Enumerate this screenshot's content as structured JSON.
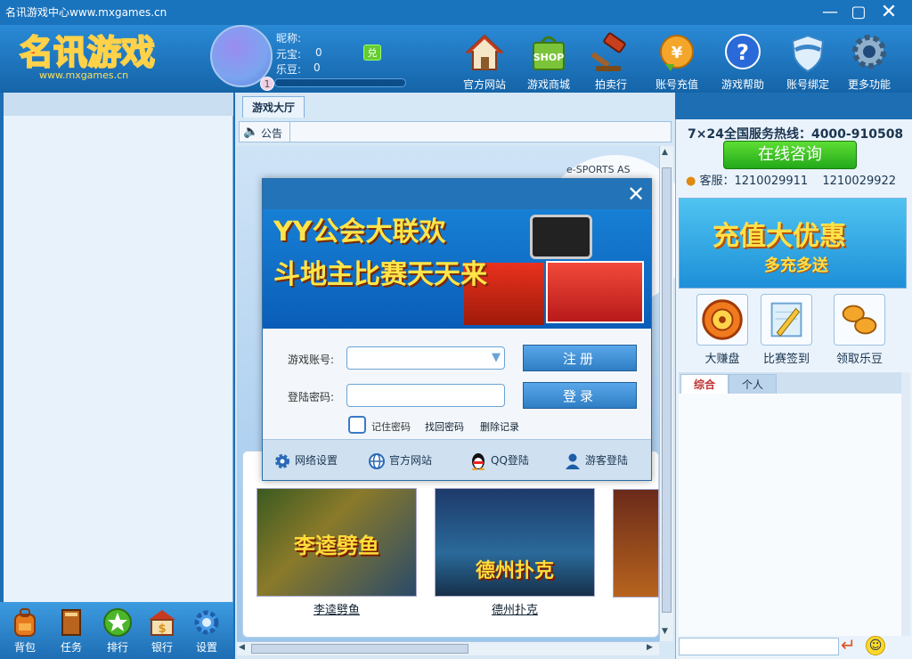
{
  "window": {
    "title": "名讯游戏中心www.mxgames.cn"
  },
  "logo": {
    "text": "名讯游戏",
    "sub": "www.mxgames.cn"
  },
  "user": {
    "nickname_label": "昵称:",
    "yuanbao_label": "元宝:",
    "yuanbao_value": "0",
    "ledou_label": "乐豆:",
    "ledou_value": "0",
    "level": "1",
    "exchange_label": "兑"
  },
  "nav": [
    {
      "label": "官方网站",
      "icon": "house-icon"
    },
    {
      "label": "游戏商城",
      "icon": "shop-bag-icon",
      "badge": "SHOP"
    },
    {
      "label": "拍卖行",
      "icon": "gavel-icon"
    },
    {
      "label": "账号充值",
      "icon": "coin-yuan-icon"
    },
    {
      "label": "游戏帮助",
      "icon": "help-icon"
    },
    {
      "label": "账号绑定",
      "icon": "shield-icon"
    },
    {
      "label": "更多功能",
      "icon": "gear-icon"
    }
  ],
  "left_bottom": [
    {
      "label": "背包",
      "icon": "backpack-icon"
    },
    {
      "label": "任务",
      "icon": "book-icon"
    },
    {
      "label": "排行",
      "icon": "star-icon"
    },
    {
      "label": "银行",
      "icon": "bank-icon"
    },
    {
      "label": "设置",
      "icon": "gear-icon"
    }
  ],
  "center": {
    "tab": "游戏大厅",
    "notice_label": "公告",
    "bg_badge": "e-SPORTS AS"
  },
  "games": [
    {
      "title": "李逵劈鱼",
      "thumb_text": "李逵劈鱼"
    },
    {
      "title": "德州扑克",
      "thumb_text": "德州扑克"
    }
  ],
  "dialog": {
    "close": "✕",
    "banner_line1": "YY公会大联欢",
    "banner_line2": "斗地主比赛天天来",
    "account_label": "游戏账号:",
    "password_label": "登陆密码:",
    "register_btn": "注册",
    "login_btn": "登录",
    "remember": "记住密码",
    "recover": "找回密码",
    "delete": "删除记录",
    "footer": [
      {
        "label": "网络设置",
        "icon": "gear-icon"
      },
      {
        "label": "官方网站",
        "icon": "globe-icon"
      },
      {
        "label": "QQ登陆",
        "icon": "qq-penguin-icon"
      },
      {
        "label": "游客登陆",
        "icon": "person-icon"
      }
    ]
  },
  "right": {
    "hotline": "7×24全国服务热线：4000-910508",
    "consult_btn": "在线咨询",
    "cs_label": "客服：1210029911",
    "cs_second": "1210029922",
    "promo_line1": "充值大优惠",
    "promo_line2": "多充多送",
    "features": [
      {
        "label": "大赚盘",
        "icon": "wheel-icon"
      },
      {
        "label": "比赛签到",
        "icon": "pencil-icon"
      },
      {
        "label": "领取乐豆",
        "icon": "beans-icon"
      }
    ],
    "tabs": [
      "综合",
      "个人"
    ]
  },
  "colors": {
    "titlebar": "#1a73bd",
    "accent_green": "#23a91a",
    "banner_yellow": "#ffe54a"
  }
}
